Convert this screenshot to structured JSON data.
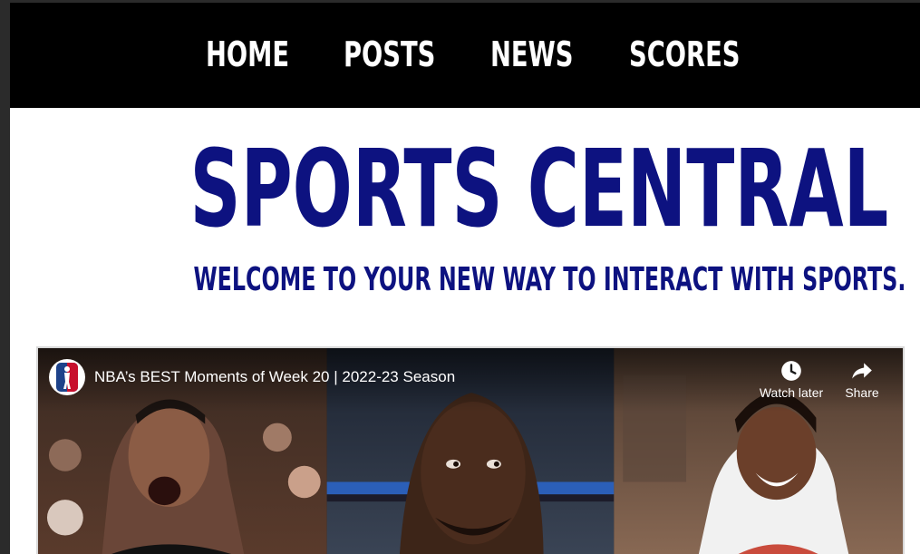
{
  "nav": {
    "items": [
      {
        "label": "HOME"
      },
      {
        "label": "POSTS"
      },
      {
        "label": "NEWS"
      },
      {
        "label": "SCORES"
      }
    ]
  },
  "hero": {
    "title": "SPORTS CENTRAL",
    "tagline": "WELCOME TO YOUR NEW WAY TO INTERACT WITH SPORTS."
  },
  "video": {
    "title": "NBA’s BEST Moments of Week 20 | 2022-23 Season",
    "channel_icon": "nba-logo",
    "actions": {
      "watch_later": {
        "label": "Watch later",
        "icon": "clock-icon"
      },
      "share": {
        "label": "Share",
        "icon": "share-arrow-icon"
      }
    }
  },
  "colors": {
    "navbar_bg": "#000000",
    "nav_text": "#ffffff",
    "brand_blue": "#0d1280",
    "page_bg": "#ffffff"
  }
}
